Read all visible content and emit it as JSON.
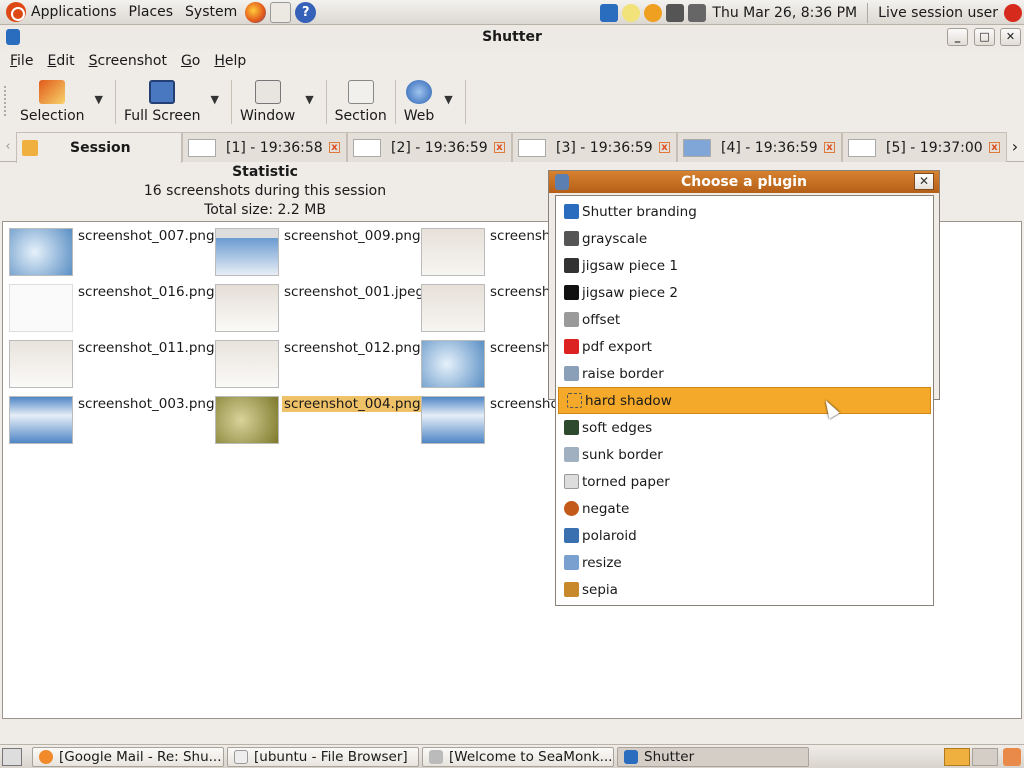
{
  "topbar": {
    "menus": [
      "Applications",
      "Places",
      "System"
    ],
    "clock": "Thu Mar 26,  8:36 PM",
    "user": "Live session user"
  },
  "window": {
    "title": "Shutter"
  },
  "menubar": [
    "File",
    "Edit",
    "Screenshot",
    "Go",
    "Help"
  ],
  "toolbar": {
    "selection": "Selection",
    "fullscreen": "Full Screen",
    "window": "Window",
    "section": "Section",
    "web": "Web"
  },
  "tabs": [
    {
      "label": "Session"
    },
    {
      "label": "[1] - 19:36:58"
    },
    {
      "label": "[2] - 19:36:59"
    },
    {
      "label": "[3] - 19:36:59"
    },
    {
      "label": "[4] - 19:36:59"
    },
    {
      "label": "[5] - 19:37:00"
    }
  ],
  "stats": {
    "title": "Statistic",
    "count": "16 screenshots during this session",
    "size": "Total size: 2.2 MB"
  },
  "files": [
    "screenshot_007.png",
    "screenshot_009.png",
    "screensho",
    "screenshot_016.png",
    "screenshot_001.jpeg",
    "screensho",
    "screenshot_011.png",
    "screenshot_012.png",
    "screensho",
    "screenshot_003.png",
    "screenshot_004.png",
    "screenshot"
  ],
  "plugin_dialog": {
    "title": "Choose a plugin"
  },
  "plugins": [
    "Shutter branding",
    "grayscale",
    "jigsaw piece 1",
    "jigsaw piece 2",
    "offset",
    "pdf export",
    "raise border",
    "hard shadow",
    "soft edges",
    "sunk border",
    "torned paper",
    "negate",
    "polaroid",
    "resize",
    "sepia"
  ],
  "highlighted_plugin": "hard shadow",
  "taskbar": [
    "[Google Mail - Re: Shu...",
    "[ubuntu - File Browser]",
    "[Welcome to SeaMonk...",
    "Shutter"
  ],
  "colors": {
    "accent": "#f4a92a",
    "dialog_header": "#c56b1e",
    "selected_item": "#f0c268"
  }
}
